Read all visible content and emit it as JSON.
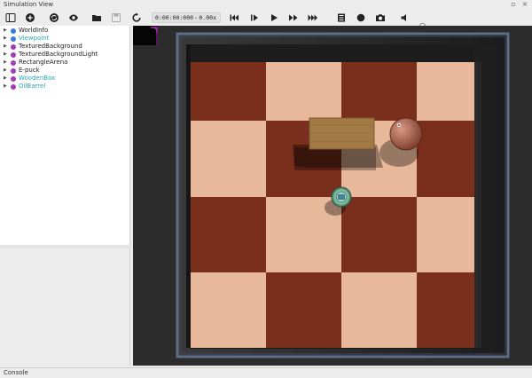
{
  "window": {
    "title": "Simulation View"
  },
  "toolbar": {
    "time": "0:00:00:000",
    "time_sep": "-",
    "speed": "0.00x",
    "volume_level": 0.0
  },
  "scene_tree": {
    "items": [
      {
        "label": "WorldInfo",
        "icon_color": "#3a7bd5",
        "proto": false
      },
      {
        "label": "Viewpoint",
        "icon_color": "#3a7bd5",
        "proto": true
      },
      {
        "label": "TexturedBackground",
        "icon_color": "#a23bb8",
        "proto": false
      },
      {
        "label": "TexturedBackgroundLight",
        "icon_color": "#a23bb8",
        "proto": false
      },
      {
        "label": "RectangleArena",
        "icon_color": "#a23bb8",
        "proto": false
      },
      {
        "label": "E-puck",
        "icon_color": "#a23bb8",
        "proto": false
      },
      {
        "label": "WoodenBox",
        "icon_color": "#a23bb8",
        "proto": true
      },
      {
        "label": "OilBarrel",
        "icon_color": "#a23bb8",
        "proto": true
      }
    ]
  },
  "console": {
    "label": "Console"
  },
  "colors": {
    "dark_tile": "#7a2e1c",
    "light_tile": "#e8b89a",
    "arena_wall": "#1e1e20",
    "accent": "#2aa7b5"
  }
}
